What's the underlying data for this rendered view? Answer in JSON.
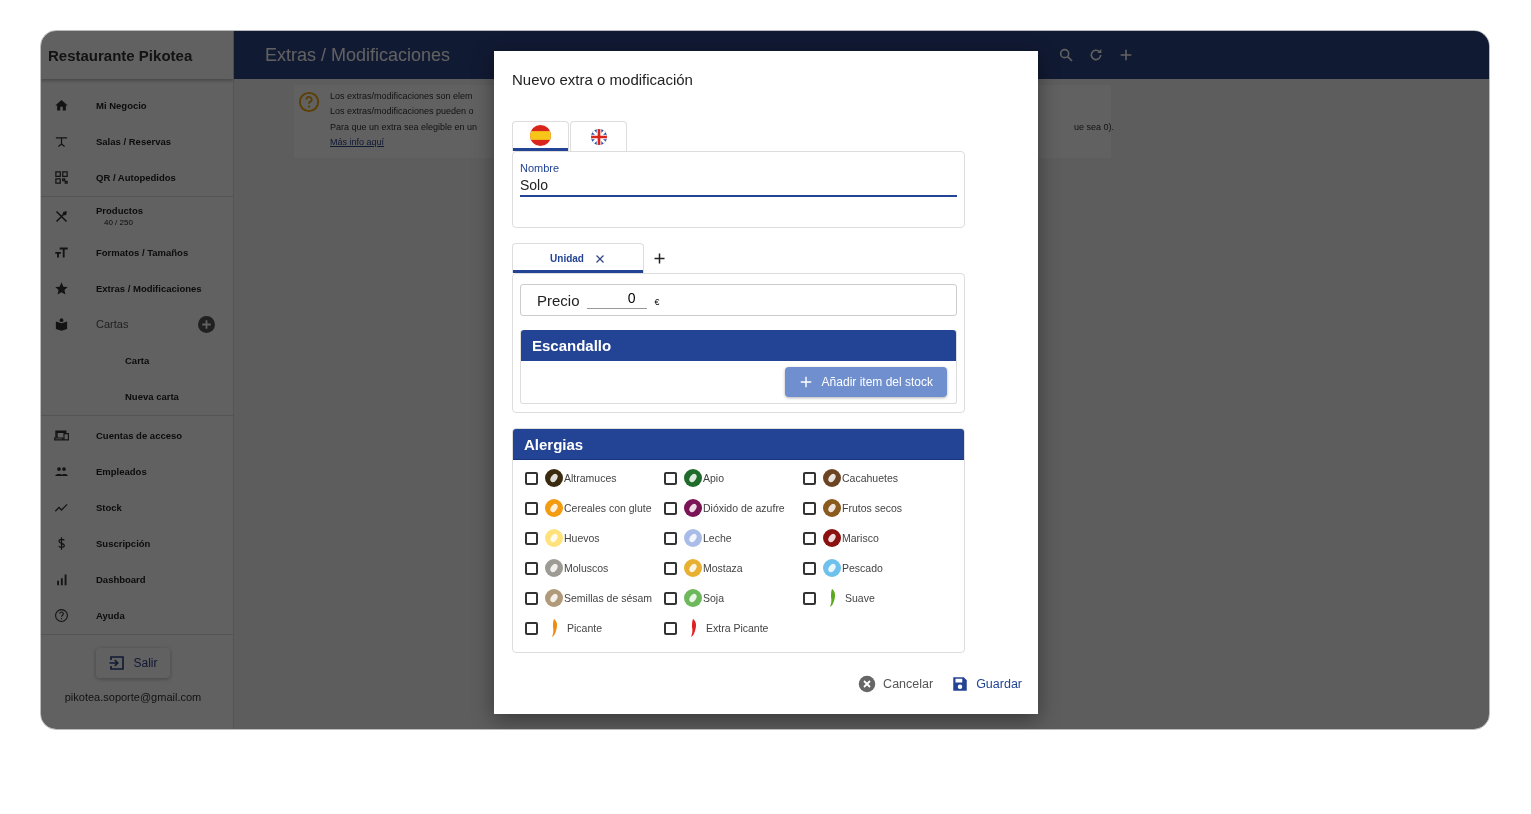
{
  "sidebar": {
    "title": "Restaurante Pikotea",
    "groups": [
      {
        "items": [
          {
            "label": "Mi Negocio"
          },
          {
            "label": "Salas / Reservas"
          },
          {
            "label": "QR / Autopedidos"
          }
        ]
      },
      {
        "items": [
          {
            "label": "Productos",
            "sub": "40 / 250"
          },
          {
            "label": "Formatos / Tamaños"
          },
          {
            "label": "Extras / Modificaciones"
          },
          {
            "label": "Cartas",
            "children": [
              {
                "label": "Carta"
              },
              {
                "label": "Nueva carta"
              }
            ]
          }
        ]
      },
      {
        "items": [
          {
            "label": "Cuentas de acceso"
          },
          {
            "label": "Empleados"
          },
          {
            "label": "Stock"
          },
          {
            "label": "Suscripción"
          },
          {
            "label": "Dashboard"
          },
          {
            "label": "Ayuda"
          }
        ]
      }
    ],
    "logout_button": "Salir",
    "email": "pikotea.soporte@gmail.com"
  },
  "header": {
    "title": "Extras / Modificaciones"
  },
  "info_card": {
    "lines": [
      "Los extras/modificaciones son elem",
      "Los extras/modificaciones pueden o",
      "Para que un extra sea elegible en un"
    ],
    "line_3_end": "ue sea 0).",
    "link": "Más info aquí"
  },
  "dialog": {
    "title": "Nuevo extra o modificación",
    "language_tabs": [
      {
        "kind": "es",
        "selected": true
      },
      {
        "kind": "gb",
        "selected": false
      }
    ],
    "name_field": {
      "label": "Nombre",
      "value": "Solo"
    },
    "variant_tabs": [
      {
        "label": "Unidad",
        "selected": true
      }
    ],
    "price": {
      "label": "Precio",
      "value": "0",
      "currency": "€"
    },
    "escandallo": {
      "title": "Escandallo",
      "add_button": "Añadir item del stock"
    },
    "allergies": {
      "title": "Alergias",
      "items": [
        {
          "label": "Altramuces",
          "kind": "allergen",
          "color": "#3a2a10",
          "checked": false
        },
        {
          "label": "Apio",
          "kind": "allergen",
          "color": "#1e6b2a",
          "checked": false
        },
        {
          "label": "Cacahuetes",
          "kind": "allergen",
          "color": "#6b4423",
          "checked": false
        },
        {
          "label": "Cereales con glute",
          "kind": "allergen",
          "color": "#f39c12",
          "checked": false
        },
        {
          "label": "Dióxido de azufre",
          "kind": "allergen",
          "color": "#7b1457",
          "checked": false
        },
        {
          "label": "Frutos secos",
          "kind": "allergen",
          "color": "#8a5a1e",
          "checked": false
        },
        {
          "label": "Huevos",
          "kind": "allergen",
          "color": "#ffe27a",
          "checked": false
        },
        {
          "label": "Leche",
          "kind": "allergen",
          "color": "#a9bce8",
          "checked": false
        },
        {
          "label": "Marisco",
          "kind": "allergen",
          "color": "#8b1010",
          "checked": false
        },
        {
          "label": "Moluscos",
          "kind": "allergen",
          "color": "#9e9a94",
          "checked": false
        },
        {
          "label": "Mostaza",
          "kind": "allergen",
          "color": "#e8b030",
          "checked": false
        },
        {
          "label": "Pescado",
          "kind": "allergen",
          "color": "#6ec1ec",
          "checked": false
        },
        {
          "label": "Semillas de sésam",
          "kind": "allergen",
          "color": "#b09a7a",
          "checked": false
        },
        {
          "label": "Soja",
          "kind": "allergen",
          "color": "#6cb85a",
          "checked": false
        },
        {
          "label": "Suave",
          "kind": "pepper",
          "color": "#5aa91c",
          "checked": false
        },
        {
          "label": "Picante",
          "kind": "pepper",
          "color": "#f08a10",
          "checked": false
        },
        {
          "label": "Extra Picante",
          "kind": "pepper",
          "color": "#e02020",
          "checked": false
        }
      ]
    },
    "buttons": {
      "cancel": "Cancelar",
      "save": "Guardar"
    }
  }
}
